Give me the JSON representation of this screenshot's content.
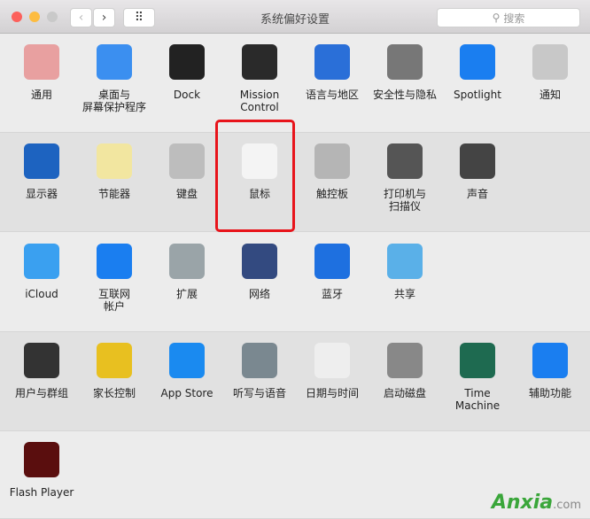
{
  "window": {
    "title": "系统偏好设置",
    "search_placeholder": "搜索",
    "back": "‹",
    "forward": "›",
    "grid": "⠿"
  },
  "rows": [
    [
      {
        "label": "通用",
        "icon": "general-icon",
        "color": "#e8a0a0"
      },
      {
        "label": "桌面与\n屏幕保护程序",
        "icon": "desktop-icon",
        "color": "#3b8ff0"
      },
      {
        "label": "Dock",
        "icon": "dock-icon",
        "color": "#222222"
      },
      {
        "label": "Mission\nControl",
        "icon": "mission-control-icon",
        "color": "#2a2a2a"
      },
      {
        "label": "语言与地区",
        "icon": "language-flag-icon",
        "color": "#2a6fd8"
      },
      {
        "label": "安全性与隐私",
        "icon": "security-house-icon",
        "color": "#777777"
      },
      {
        "label": "Spotlight",
        "icon": "spotlight-icon",
        "color": "#1a7ef0"
      },
      {
        "label": "通知",
        "icon": "notifications-icon",
        "color": "#c8c8c8"
      }
    ],
    [
      {
        "label": "显示器",
        "icon": "display-icon",
        "color": "#1d63c0"
      },
      {
        "label": "节能器",
        "icon": "energy-saver-bulb-icon",
        "color": "#f2e6a0"
      },
      {
        "label": "键盘",
        "icon": "keyboard-icon",
        "color": "#bdbdbd"
      },
      {
        "label": "鼠标",
        "icon": "mouse-icon",
        "color": "#f4f4f4"
      },
      {
        "label": "触控板",
        "icon": "trackpad-icon",
        "color": "#b5b5b5"
      },
      {
        "label": "打印机与\n扫描仪",
        "icon": "printer-icon",
        "color": "#555555"
      },
      {
        "label": "声音",
        "icon": "speaker-icon",
        "color": "#444444"
      }
    ],
    [
      {
        "label": "iCloud",
        "icon": "icloud-icon",
        "color": "#3aa0f0"
      },
      {
        "label": "互联网\n帐户",
        "icon": "internet-accounts-icon",
        "color": "#1a7ef0"
      },
      {
        "label": "扩展",
        "icon": "extensions-puzzle-icon",
        "color": "#9aa4a8"
      },
      {
        "label": "网络",
        "icon": "network-globe-icon",
        "color": "#334a80"
      },
      {
        "label": "蓝牙",
        "icon": "bluetooth-icon",
        "color": "#1e70e0"
      },
      {
        "label": "共享",
        "icon": "sharing-folder-icon",
        "color": "#5ab0e8"
      }
    ],
    [
      {
        "label": "用户与群组",
        "icon": "users-groups-icon",
        "color": "#333333"
      },
      {
        "label": "家长控制",
        "icon": "parental-controls-icon",
        "color": "#e8c020"
      },
      {
        "label": "App Store",
        "icon": "app-store-icon",
        "color": "#1a8af0"
      },
      {
        "label": "听写与语音",
        "icon": "dictation-mic-icon",
        "color": "#7a8890"
      },
      {
        "label": "日期与时间",
        "icon": "date-time-clock-icon",
        "color": "#eeeeee"
      },
      {
        "label": "启动磁盘",
        "icon": "startup-disk-icon",
        "color": "#888888"
      },
      {
        "label": "Time Machine",
        "icon": "time-machine-icon",
        "color": "#1e6a50"
      },
      {
        "label": "辅助功能",
        "icon": "accessibility-icon",
        "color": "#1a7ef0"
      }
    ],
    [
      {
        "label": "Flash Player",
        "icon": "flash-player-icon",
        "color": "#5a0e0e"
      }
    ]
  ],
  "watermark": {
    "brand": "Anxia",
    "suffix": ".com"
  }
}
